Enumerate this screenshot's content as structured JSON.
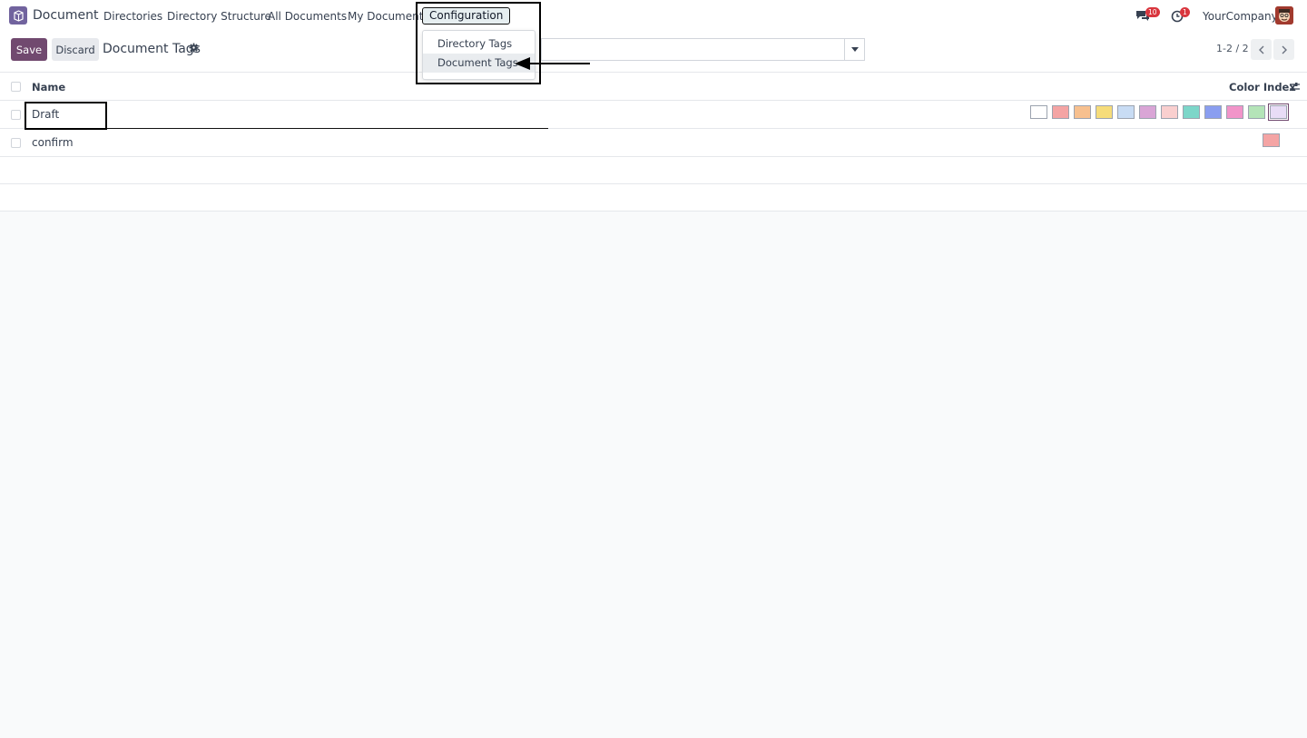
{
  "navbar": {
    "app_name": "Document",
    "items": [
      "Directories",
      "Directory Structure",
      "All Documents",
      "My Documents"
    ],
    "config_label": "Configuration",
    "chat_count": "10",
    "activity_count": "1",
    "company": "YourCompany"
  },
  "dropdown": {
    "items": [
      "Directory Tags",
      "Document Tags"
    ]
  },
  "control": {
    "save_label": "Save",
    "discard_label": "Discard",
    "title": "Document Tags",
    "pager": "1-2 / 2"
  },
  "list": {
    "columns": [
      "Name",
      "Color Index"
    ],
    "rows": [
      {
        "name": "Draft"
      },
      {
        "name": "confirm"
      }
    ],
    "palette": [
      "#ffffff",
      "#f4a4a4",
      "#f7c08f",
      "#f6dc7a",
      "#c8dcf4",
      "#d9a5d6",
      "#f9cfcf",
      "#7cd6c9",
      "#8a9ef0",
      "#f194c9",
      "#b4e4b8",
      "#e8dcf6"
    ],
    "confirm_color": "#f4a4a4"
  },
  "colors": {
    "brand": "#71496f",
    "logo": "#71639e"
  }
}
